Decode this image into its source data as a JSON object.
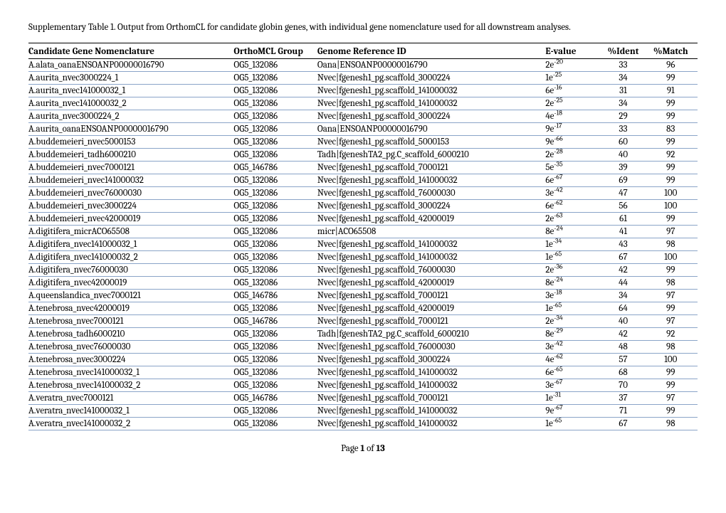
{
  "caption": "Supplementary Table 1. Output from OrthomCL for candidate globin genes, with individual gene nomenclature used for all downstream analyses.",
  "headers": [
    "Candidate Gene Nomenclature",
    "OrthoMCL Group",
    "Genome Reference ID",
    "E-value",
    "%Ident",
    "%Match"
  ],
  "rows": [
    {
      "c1": "A.alata_oanaENSOANP00000016790",
      "c2": "OG5_132086",
      "c3": "Oana|ENSOANP00000016790",
      "ev_b": "2e",
      "ev_e": "-20",
      "id": "33",
      "m": "96"
    },
    {
      "c1": "A.aurita_nvec3000224_1",
      "c2": "OG5_132086",
      "c3": "Nvec|fgenesh1_pg.scaffold_3000224",
      "ev_b": "1e",
      "ev_e": "-25",
      "id": "34",
      "m": "99"
    },
    {
      "c1": "A.aurita_nvec141000032_1",
      "c2": "OG5_132086",
      "c3": "Nvec|fgenesh1_pg.scaffold_141000032",
      "ev_b": "6e",
      "ev_e": "-16",
      "id": "31",
      "m": "91"
    },
    {
      "c1": "A.aurita_nvec141000032_2",
      "c2": "OG5_132086",
      "c3": "Nvec|fgenesh1_pg.scaffold_141000032",
      "ev_b": "2e",
      "ev_e": "-25",
      "id": "34",
      "m": "99"
    },
    {
      "c1": "A.aurita_nvec3000224_2",
      "c2": "OG5_132086",
      "c3": "Nvec|fgenesh1_pg.scaffold_3000224",
      "ev_b": "4e",
      "ev_e": "-18",
      "id": "29",
      "m": "99"
    },
    {
      "c1": "A.aurita_oanaENSOANP00000016790",
      "c2": "OG5_132086",
      "c3": "Oana|ENSOANP00000016790",
      "ev_b": "9e",
      "ev_e": "-17",
      "id": "33",
      "m": "83"
    },
    {
      "c1": "A.buddemeieri_nvec5000153",
      "c2": "OG5_132086",
      "c3": "Nvec|fgenesh1_pg.scaffold_5000153",
      "ev_b": "9e",
      "ev_e": "-66",
      "id": "60",
      "m": "99"
    },
    {
      "c1": "A.buddemeieri_tadh6000210",
      "c2": "OG5_132086",
      "c3": "Tadh|fgeneshTA2_pg.C_scaffold_6000210",
      "ev_b": "2e",
      "ev_e": "-28",
      "id": "40",
      "m": "92"
    },
    {
      "c1": "A.buddemeieri_nvec7000121",
      "c2": "OG5_146786",
      "c3": "Nvec|fgenesh1_pg.scaffold_7000121",
      "ev_b": "5e",
      "ev_e": "-35",
      "id": "39",
      "m": "99"
    },
    {
      "c1": "A.buddemeieri_nvec141000032",
      "c2": "OG5_132086",
      "c3": "Nvec|fgenesh1_pg.scaffold_141000032",
      "ev_b": "6e",
      "ev_e": "-67",
      "id": "69",
      "m": "99"
    },
    {
      "c1": "A.buddemeieri_nvec76000030",
      "c2": "OG5_132086",
      "c3": "Nvec|fgenesh1_pg.scaffold_76000030",
      "ev_b": "3e",
      "ev_e": "-42",
      "id": "47",
      "m": "100"
    },
    {
      "c1": "A.buddemeieri_nvec3000224",
      "c2": "OG5_132086",
      "c3": "Nvec|fgenesh1_pg.scaffold_3000224",
      "ev_b": "6e",
      "ev_e": "-62",
      "id": "56",
      "m": "100"
    },
    {
      "c1": "A.buddemeieri_nvec42000019",
      "c2": "OG5_132086",
      "c3": "Nvec|fgenesh1_pg.scaffold_42000019",
      "ev_b": "2e",
      "ev_e": "-63",
      "id": "61",
      "m": "99"
    },
    {
      "c1": "A.digitifera_micrACO65508",
      "c2": "OG5_132086",
      "c3": "micr|ACO65508",
      "ev_b": "8e",
      "ev_e": "-24",
      "id": "41",
      "m": "97"
    },
    {
      "c1": "A.digitifera_nvec141000032_1",
      "c2": "OG5_132086",
      "c3": "Nvec|fgenesh1_pg.scaffold_141000032",
      "ev_b": "1e",
      "ev_e": "-34",
      "id": "43",
      "m": "98"
    },
    {
      "c1": "A.digitifera_nvec141000032_2",
      "c2": "OG5_132086",
      "c3": "Nvec|fgenesh1_pg.scaffold_141000032",
      "ev_b": "1e",
      "ev_e": "-65",
      "id": "67",
      "m": "100"
    },
    {
      "c1": "A.digitifera_nvec76000030",
      "c2": "OG5_132086",
      "c3": "Nvec|fgenesh1_pg.scaffold_76000030",
      "ev_b": "2e",
      "ev_e": "-36",
      "id": "42",
      "m": "99"
    },
    {
      "c1": "A.digitifera_nvec42000019",
      "c2": "OG5_132086",
      "c3": "Nvec|fgenesh1_pg.scaffold_42000019",
      "ev_b": "8e",
      "ev_e": "-24",
      "id": "44",
      "m": "98"
    },
    {
      "c1": "A.queenslandica_nvec7000121",
      "c2": "OG5_146786",
      "c3": "Nvec|fgenesh1_pg.scaffold_7000121",
      "ev_b": "3e",
      "ev_e": "-18",
      "id": "34",
      "m": "97"
    },
    {
      "c1": "A.tenebrosa_nvec42000019",
      "c2": "OG5_132086",
      "c3": "Nvec|fgenesh1_pg.scaffold_42000019",
      "ev_b": "1e",
      "ev_e": "-65",
      "id": "64",
      "m": "99"
    },
    {
      "c1": "A.tenebrosa_nvec7000121",
      "c2": "OG5_146786",
      "c3": "Nvec|fgenesh1_pg.scaffold_7000121",
      "ev_b": "2e",
      "ev_e": "-34",
      "id": "40",
      "m": "97"
    },
    {
      "c1": "A.tenebrosa_tadh6000210",
      "c2": "OG5_132086",
      "c3": "Tadh|fgeneshTA2_pg.C_scaffold_6000210",
      "ev_b": "8e",
      "ev_e": "-29",
      "id": "42",
      "m": "92"
    },
    {
      "c1": "A.tenebrosa_nvec76000030",
      "c2": "OG5_132086",
      "c3": "Nvec|fgenesh1_pg.scaffold_76000030",
      "ev_b": "3e",
      "ev_e": "-42",
      "id": "48",
      "m": "98"
    },
    {
      "c1": "A.tenebrosa_nvec3000224",
      "c2": "OG5_132086",
      "c3": "Nvec|fgenesh1_pg.scaffold_3000224",
      "ev_b": "4e",
      "ev_e": "-62",
      "id": "57",
      "m": "100"
    },
    {
      "c1": "A.tenebrosa_nvec141000032_1",
      "c2": "OG5_132086",
      "c3": "Nvec|fgenesh1_pg.scaffold_141000032",
      "ev_b": "6e",
      "ev_e": "-65",
      "id": "68",
      "m": "99"
    },
    {
      "c1": "A.tenebrosa_nvec141000032_2",
      "c2": "OG5_132086",
      "c3": "Nvec|fgenesh1_pg.scaffold_141000032",
      "ev_b": "3e",
      "ev_e": "-67",
      "id": "70",
      "m": "99"
    },
    {
      "c1": "A.veratra_nvec7000121",
      "c2": "OG5_146786",
      "c3": "Nvec|fgenesh1_pg.scaffold_7000121",
      "ev_b": "1e",
      "ev_e": "-31",
      "id": "37",
      "m": "97"
    },
    {
      "c1": "A.veratra_nvec141000032_1",
      "c2": "OG5_132086",
      "c3": "Nvec|fgenesh1_pg.scaffold_141000032",
      "ev_b": "9e",
      "ev_e": "-67",
      "id": "71",
      "m": "99"
    },
    {
      "c1": "A.veratra_nvec141000032_2",
      "c2": "OG5_132086",
      "c3": "Nvec|fgenesh1_pg.scaffold_141000032",
      "ev_b": "1e",
      "ev_e": "-65",
      "id": "67",
      "m": "98"
    }
  ],
  "footer": {
    "prefix": "Page ",
    "n": "1",
    "of": " of ",
    "total": "13"
  }
}
